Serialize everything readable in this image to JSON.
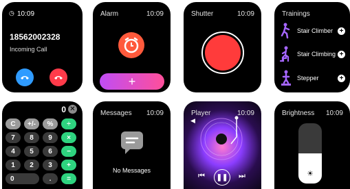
{
  "incoming_call": {
    "time": "10:09",
    "number": "18562002328",
    "status": "Incoming Call"
  },
  "alarm": {
    "title": "Alarm",
    "time": "10:09",
    "add_label": "+"
  },
  "shutter": {
    "title": "Shutter",
    "time": "10:09"
  },
  "trainings": {
    "title": "Trainings",
    "items": [
      {
        "label": "Stair Climber"
      },
      {
        "label": "Stair Climbing"
      },
      {
        "label": "Stepper"
      }
    ]
  },
  "calculator": {
    "display": "0",
    "keys": [
      [
        "C",
        "+/-",
        "%",
        "÷"
      ],
      [
        "7",
        "8",
        "9",
        "×"
      ],
      [
        "4",
        "5",
        "6",
        "−"
      ],
      [
        "1",
        "2",
        "3",
        "+"
      ],
      [
        "0",
        "",
        ".",
        "="
      ]
    ]
  },
  "messages": {
    "title": "Messages",
    "time": "10:09",
    "empty_text": "No Messages"
  },
  "player": {
    "title": "Player",
    "time": "10:09"
  },
  "brightness": {
    "title": "Brightness",
    "time": "10:09",
    "level": 0.5
  },
  "colors": {
    "accept": "#2f9bff",
    "decline": "#ff3b4a",
    "alarm": "#ff5a3c",
    "shutter": "#ff3b3b",
    "training_icon": "#a566ff",
    "calc_op": "#2ed37f",
    "messages_icon": "#9a9a9a"
  }
}
